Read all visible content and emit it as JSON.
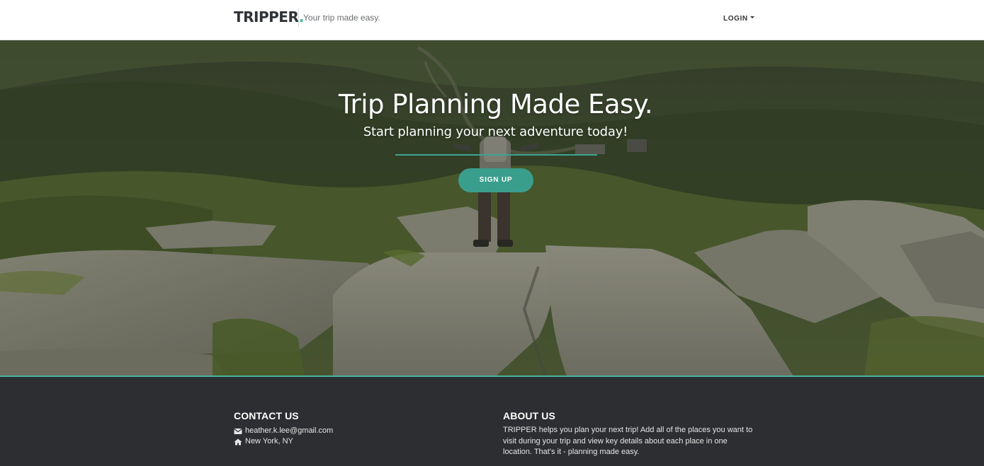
{
  "header": {
    "brand_name": "TRIPPER",
    "brand_dot": ".",
    "tagline": "Your trip made easy.",
    "login_label": "LOGIN",
    "accent_color": "#3bb59b"
  },
  "hero": {
    "title": "Trip Planning Made Easy.",
    "subtitle": "Start planning your next adventure today!",
    "signup_label": "SIGN UP",
    "button_color": "#3a9e8c",
    "background_description_icon": "mountain-hiker-photo"
  },
  "footer": {
    "contact": {
      "title": "CONTACT US",
      "email": "heather.k.lee@gmail.com",
      "email_icon": "envelope-icon",
      "location": "New York, NY",
      "location_icon": "home-icon"
    },
    "about": {
      "title": "ABOUT US",
      "text": "TRIPPER helps you plan your next trip! Add all of the places you want to visit during your trip and view key details about each place in one location. That's it - planning made easy."
    },
    "background_color": "#2c2e31"
  }
}
